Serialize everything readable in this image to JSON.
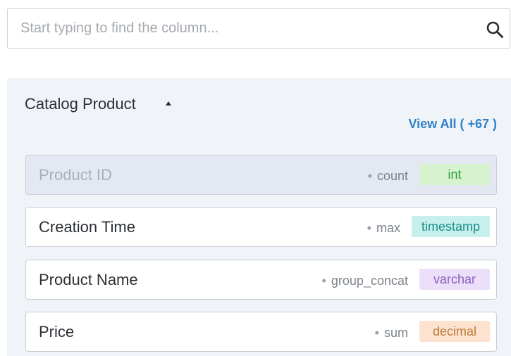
{
  "search": {
    "placeholder": "Start typing to find the column..."
  },
  "panel": {
    "title": "Catalog Product",
    "view_all": "View All ( +67 )"
  },
  "columns": [
    {
      "label": "Product ID",
      "aggregation": "count",
      "type": "int",
      "type_color": "#2f9e3a",
      "type_bg": "#d6f2cf",
      "disabled": true
    },
    {
      "label": "Creation Time",
      "aggregation": "max",
      "type": "timestamp",
      "type_color": "#178f8c",
      "type_bg": "#c7f0ec",
      "disabled": false
    },
    {
      "label": "Product Name",
      "aggregation": "group_concat",
      "type": "varchar",
      "type_color": "#8e5fbf",
      "type_bg": "#ecdffa",
      "disabled": false
    },
    {
      "label": "Price",
      "aggregation": "sum",
      "type": "decimal",
      "type_color": "#c07a3a",
      "type_bg": "#fde3cf",
      "disabled": false
    }
  ]
}
